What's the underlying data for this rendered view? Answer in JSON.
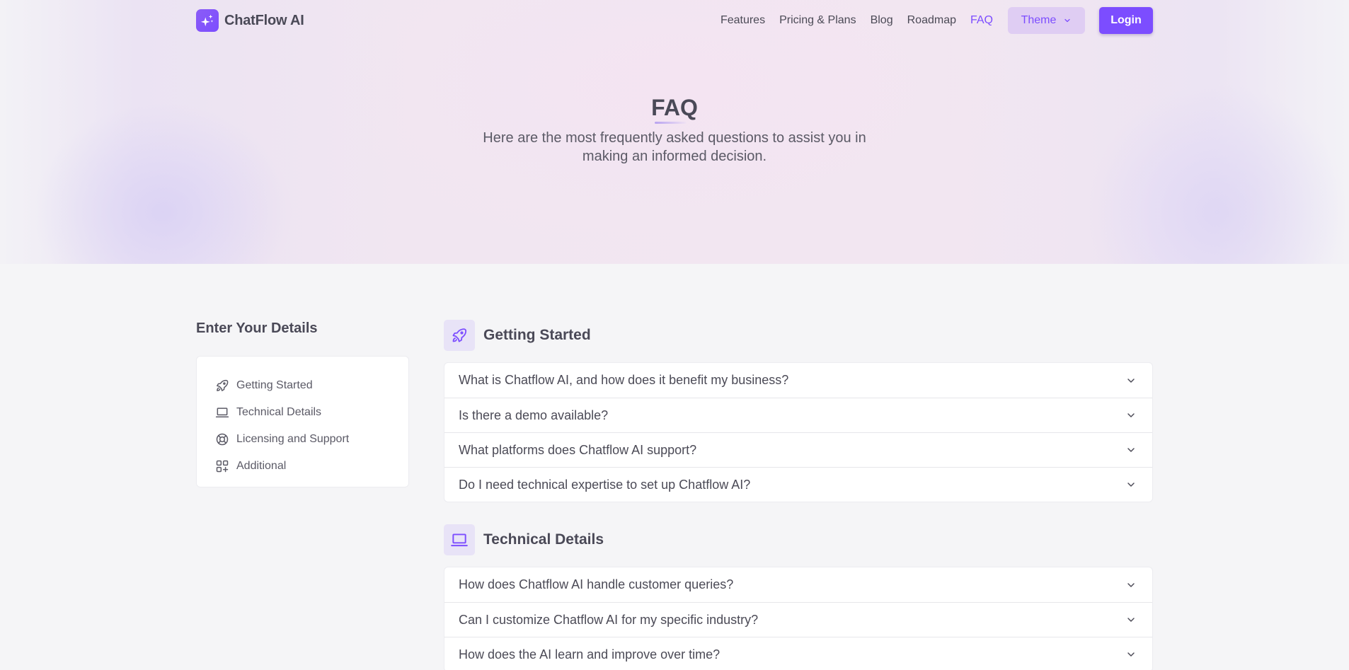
{
  "brand": {
    "name": "ChatFlow AI",
    "icon": "sparkles-icon"
  },
  "nav": {
    "links": [
      {
        "label": "Features",
        "active": false
      },
      {
        "label": "Pricing & Plans",
        "active": false
      },
      {
        "label": "Blog",
        "active": false
      },
      {
        "label": "Roadmap",
        "active": false
      },
      {
        "label": "FAQ",
        "active": true
      }
    ],
    "theme_label": "Theme",
    "login_label": "Login"
  },
  "hero": {
    "title": "FAQ",
    "subtitle": "Here are the most frequently asked questions to assist you in making an informed decision."
  },
  "sidebar": {
    "title": "Enter Your Details",
    "items": [
      {
        "label": "Getting Started",
        "icon": "rocket-icon"
      },
      {
        "label": "Technical Details",
        "icon": "laptop-icon"
      },
      {
        "label": "Licensing and Support",
        "icon": "lifebuoy-icon"
      },
      {
        "label": "Additional",
        "icon": "grid-plus-icon"
      }
    ]
  },
  "sections": [
    {
      "title": "Getting Started",
      "icon": "rocket-icon",
      "questions": [
        "What is Chatflow AI, and how does it benefit my business?",
        "Is there a demo available?",
        "What platforms does Chatflow AI support?",
        "Do I need technical expertise to set up Chatflow AI?"
      ]
    },
    {
      "title": "Technical Details",
      "icon": "laptop-icon",
      "questions": [
        "How does Chatflow AI handle customer queries?",
        "Can I customize Chatflow AI for my specific industry?",
        "How does the AI learn and improve over time?"
      ]
    }
  ],
  "colors": {
    "accent": "#7c4dff",
    "theme_button_bg": "#dfcdf3",
    "section_icon_bg": "#e8e3f7",
    "text": "#4b4a56",
    "page_bg": "#f5f5f7"
  }
}
